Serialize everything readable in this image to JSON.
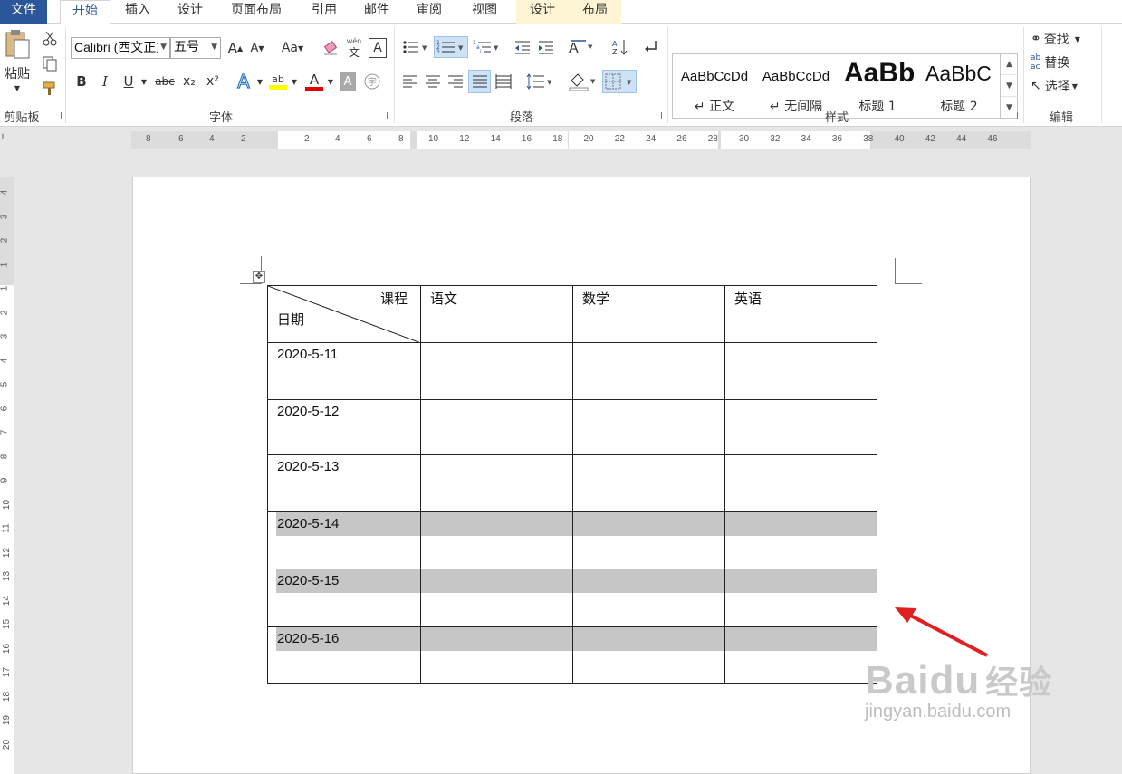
{
  "tabs": [
    {
      "label": "文件",
      "kind": "file"
    },
    {
      "label": "开始",
      "kind": "active"
    },
    {
      "label": "插入",
      "kind": ""
    },
    {
      "label": "设计",
      "kind": ""
    },
    {
      "label": "页面布局",
      "kind": ""
    },
    {
      "label": "引用",
      "kind": ""
    },
    {
      "label": "邮件",
      "kind": ""
    },
    {
      "label": "审阅",
      "kind": ""
    },
    {
      "label": "视图",
      "kind": ""
    },
    {
      "label": "设计",
      "kind": "ctx"
    },
    {
      "label": "布局",
      "kind": "ctx"
    }
  ],
  "clipboard": {
    "paste_label": "粘贴",
    "group_label": "剪贴板"
  },
  "font": {
    "name": "Calibri (西文正文",
    "size": "五号",
    "group_label": "字体",
    "grow": "A",
    "shrink": "A",
    "case": "Aa",
    "phonetic_top": "wén",
    "phonetic_bottom": "文",
    "bold": "B",
    "italic": "I",
    "underline": "U",
    "strike": "abc",
    "sub": "x₂",
    "sup": "x²",
    "highlight": "ab",
    "color": "A"
  },
  "paragraph": {
    "group_label": "段落"
  },
  "styles": {
    "group_label": "样式",
    "items": [
      {
        "sample": "AaBbCcDd",
        "name": "↵ 正文"
      },
      {
        "sample": "AaBbCcDd",
        "name": "↵ 无间隔"
      },
      {
        "sample": "AaBb",
        "name": "标题 1"
      },
      {
        "sample": "AaBbC",
        "name": "标题 2"
      }
    ]
  },
  "editing": {
    "find": "查找",
    "replace": "替换",
    "select": "选择",
    "group_label": "编辑"
  },
  "ruler": {
    "h_left": [
      "8",
      "6",
      "4",
      "2",
      "2",
      "4",
      "6",
      "8"
    ],
    "h_right": [
      "10",
      "12",
      "14",
      "16",
      "18",
      "20",
      "22",
      "24",
      "26",
      "28",
      "30",
      "32",
      "34",
      "36",
      "38",
      "40",
      "42",
      "44",
      "46"
    ],
    "v": [
      "4",
      "3",
      "2",
      "1",
      "1",
      "2",
      "3",
      "4",
      "5",
      "6",
      "7",
      "8",
      "9",
      "10",
      "11",
      "12",
      "13",
      "14",
      "15",
      "16",
      "17",
      "18",
      "19",
      "20"
    ]
  },
  "table": {
    "header_top": "课程",
    "header_bottom": "日期",
    "columns": [
      "语文",
      "数学",
      "英语"
    ],
    "rows": [
      {
        "date": "2020-5-11",
        "shaded": false
      },
      {
        "date": "2020-5-12",
        "shaded": false
      },
      {
        "date": "2020-5-13",
        "shaded": false
      },
      {
        "date": "2020-5-14",
        "shaded": true
      },
      {
        "date": "2020-5-15",
        "shaded": true
      },
      {
        "date": "2020-5-16",
        "shaded": true
      }
    ]
  },
  "watermark": {
    "brand": "Baidu",
    "cn": "经验",
    "url": "jingyan.baidu.com"
  },
  "colors": {
    "file_tab": "#2b579a",
    "shade": "#c6c6c6",
    "arrow": "#e02020",
    "highlight": "#ffff00",
    "font_color": "#e00000"
  }
}
